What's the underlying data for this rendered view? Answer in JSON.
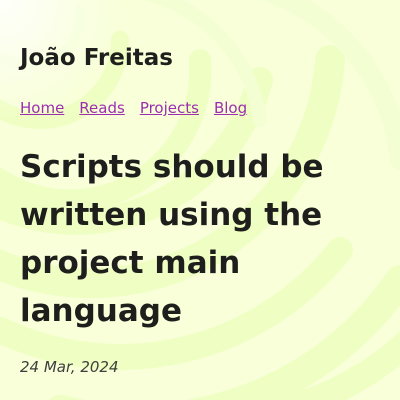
{
  "site": {
    "title": "João Freitas"
  },
  "nav": {
    "items": [
      {
        "label": "Home"
      },
      {
        "label": "Reads"
      },
      {
        "label": "Projects"
      },
      {
        "label": "Blog"
      }
    ]
  },
  "post": {
    "title": "Scripts should be written using the project main language",
    "date": "24 Mar, 2024"
  },
  "colors": {
    "background": "#f8ffd9",
    "swirl": "#eeffbf",
    "link": "#9b2fb0",
    "text": "#1e1f1c"
  }
}
